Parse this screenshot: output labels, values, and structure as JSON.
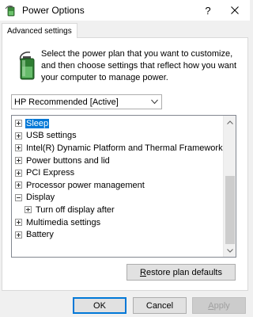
{
  "window": {
    "title": "Power Options",
    "help_symbol": "?",
    "icon": "power-options-battery-icon"
  },
  "tabs": [
    {
      "label": "Advanced settings",
      "active": true
    }
  ],
  "description": "Select the power plan that you want to customize, and then choose settings that reflect how you want your computer to manage power.",
  "plan_select": {
    "value": "HP Recommended [Active]"
  },
  "tree": {
    "items": [
      {
        "label": "Sleep",
        "expander": "plus",
        "selected": true,
        "level": 0
      },
      {
        "label": "USB settings",
        "expander": "plus",
        "selected": false,
        "level": 0
      },
      {
        "label": "Intel(R) Dynamic Platform and Thermal Framework Se",
        "expander": "plus",
        "selected": false,
        "level": 0
      },
      {
        "label": "Power buttons and lid",
        "expander": "plus",
        "selected": false,
        "level": 0
      },
      {
        "label": "PCI Express",
        "expander": "plus",
        "selected": false,
        "level": 0
      },
      {
        "label": "Processor power management",
        "expander": "plus",
        "selected": false,
        "level": 0
      },
      {
        "label": "Display",
        "expander": "minus",
        "selected": false,
        "level": 0
      },
      {
        "label": "Turn off display after",
        "expander": "plus",
        "selected": false,
        "level": 1
      },
      {
        "label": "Multimedia settings",
        "expander": "plus",
        "selected": false,
        "level": 0
      },
      {
        "label": "Battery",
        "expander": "plus",
        "selected": false,
        "level": 0
      }
    ]
  },
  "buttons": {
    "restore": "Restore plan defaults",
    "ok": "OK",
    "cancel": "Cancel",
    "apply": "Apply"
  },
  "colors": {
    "selection": "#0078d7",
    "window_bg": "#f0f0f0",
    "panel_bg": "#ffffff"
  }
}
